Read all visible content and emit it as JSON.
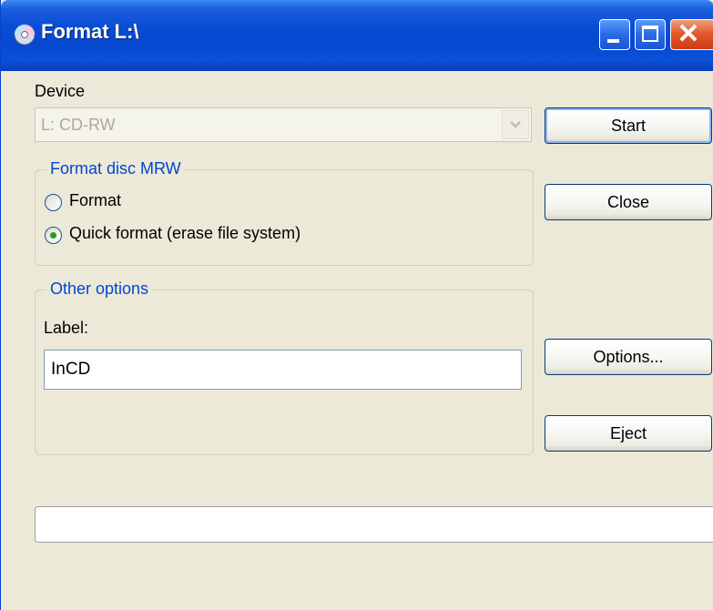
{
  "window": {
    "title": "Format L:\\",
    "title_icon": "cd-disc-icon",
    "colors": {
      "titlebar": "#0a4ed6",
      "face": "#ece9d8",
      "legend": "#0046d5",
      "close": "#e35a2c"
    }
  },
  "device": {
    "label": "Device",
    "selected": "L: CD-RW"
  },
  "format_group": {
    "legend": "Format disc MRW",
    "options": [
      {
        "label": "Format",
        "checked": false
      },
      {
        "label": "Quick format (erase file system)",
        "checked": true
      }
    ]
  },
  "other_group": {
    "legend": "Other options",
    "label_caption": "Label:",
    "label_value": "InCD"
  },
  "buttons": {
    "start": "Start",
    "close": "Close",
    "options": "Options...",
    "eject": "Eject"
  }
}
